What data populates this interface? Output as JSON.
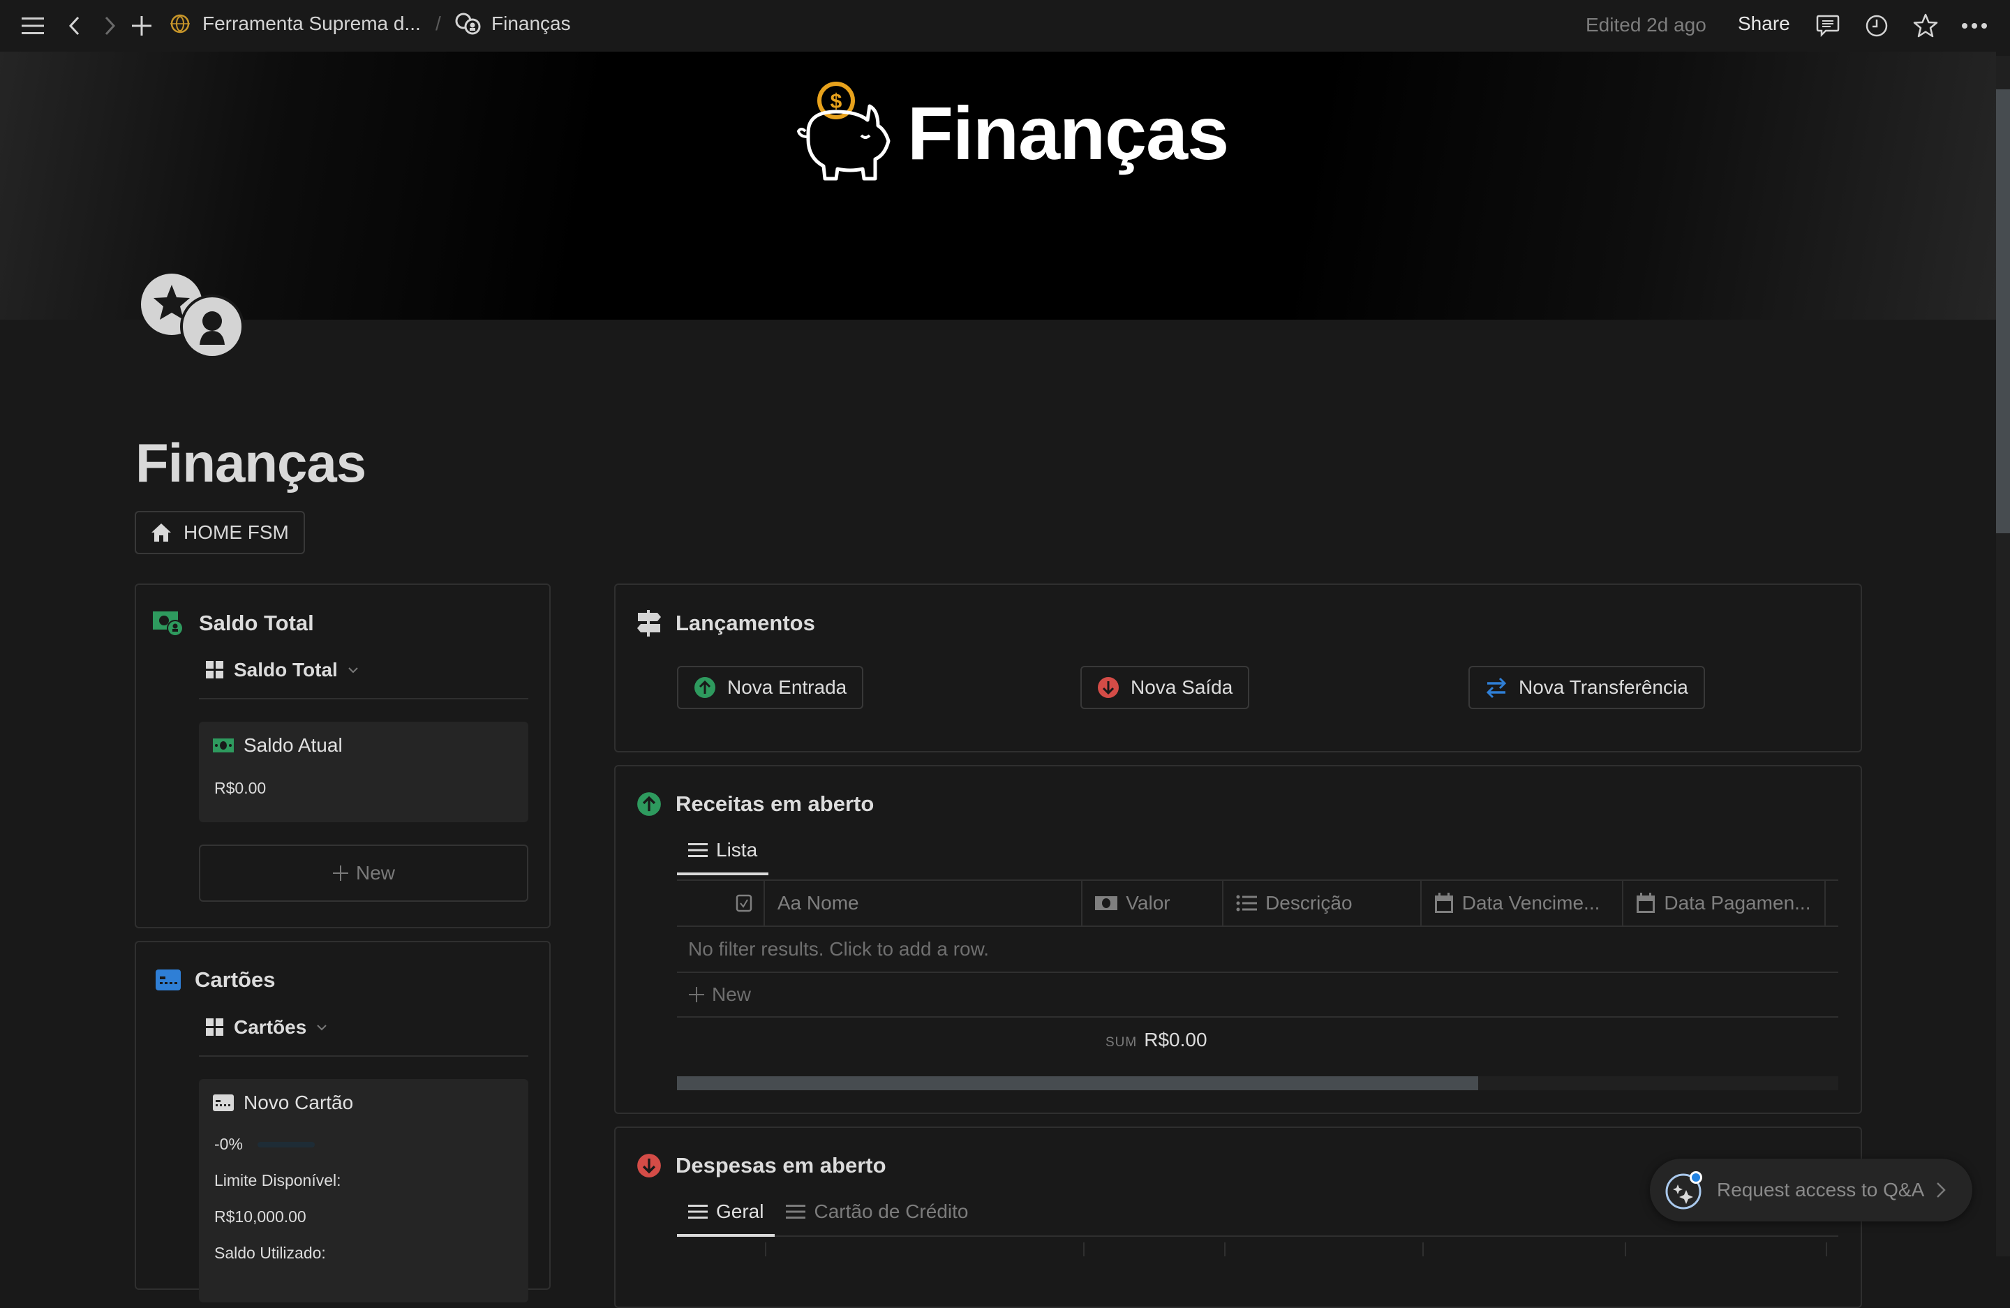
{
  "topbar": {
    "breadcrumb": [
      {
        "label": "Ferramenta Suprema d...",
        "icon": "gold-emblem-icon"
      },
      {
        "label": "Finanças",
        "icon": "coins-icon"
      }
    ],
    "separator": "/",
    "edited": "Edited 2d ago",
    "share": "Share"
  },
  "cover": {
    "title": "Finanças"
  },
  "page": {
    "title": "Finanças",
    "home_button": "HOME FSM"
  },
  "saldo_total": {
    "heading": "Saldo Total",
    "view_name": "Saldo Total",
    "card": {
      "title": "Saldo Atual",
      "value": "R$0.00"
    },
    "new_label": "New"
  },
  "cartoes": {
    "heading": "Cartões",
    "view_name": "Cartões",
    "card": {
      "title": "Novo Cartão",
      "percent_label": "-0%",
      "progress": 0,
      "limit_label": "Limite Disponível:",
      "limit_value": "R$10,000.00",
      "used_label": "Saldo Utilizado:"
    }
  },
  "lancamentos": {
    "heading": "Lançamentos",
    "buttons": [
      {
        "label": "Nova Entrada",
        "icon": "arrow-up-circle-icon",
        "color": "#2e9a5e"
      },
      {
        "label": "Nova Saída",
        "icon": "arrow-down-circle-icon",
        "color": "#d44c47"
      },
      {
        "label": "Nova Transferência",
        "icon": "transfer-arrows-icon",
        "color": "#2f7fd6"
      }
    ]
  },
  "receitas": {
    "heading": "Receitas em aberto",
    "tabs": [
      {
        "label": "Lista",
        "active": true
      }
    ],
    "columns": [
      {
        "label": "",
        "icon": "checkbox-icon"
      },
      {
        "label": "Aa Nome",
        "icon": ""
      },
      {
        "label": "Valor",
        "icon": "money-icon"
      },
      {
        "label": "Descrição",
        "icon": "list-icon"
      },
      {
        "label": "Data Vencime...",
        "icon": "calendar-icon"
      },
      {
        "label": "Data Pagamen...",
        "icon": "calendar-icon"
      }
    ],
    "empty_message": "No filter results. Click to add a row.",
    "new_label": "New",
    "sum_label": "SUM",
    "sum_value": "R$0.00",
    "scroll_fraction": 0.69
  },
  "despesas": {
    "heading": "Despesas em aberto",
    "tabs": [
      {
        "label": "Geral",
        "active": true
      },
      {
        "label": "Cartão de Crédito",
        "active": false
      }
    ]
  },
  "qa_button": {
    "label": "Request access to Q&A"
  },
  "colors": {
    "background": "#191919",
    "green": "#2e9a5e",
    "red": "#d44c47",
    "blue": "#2f7fd6",
    "gold": "#e8a21c"
  }
}
